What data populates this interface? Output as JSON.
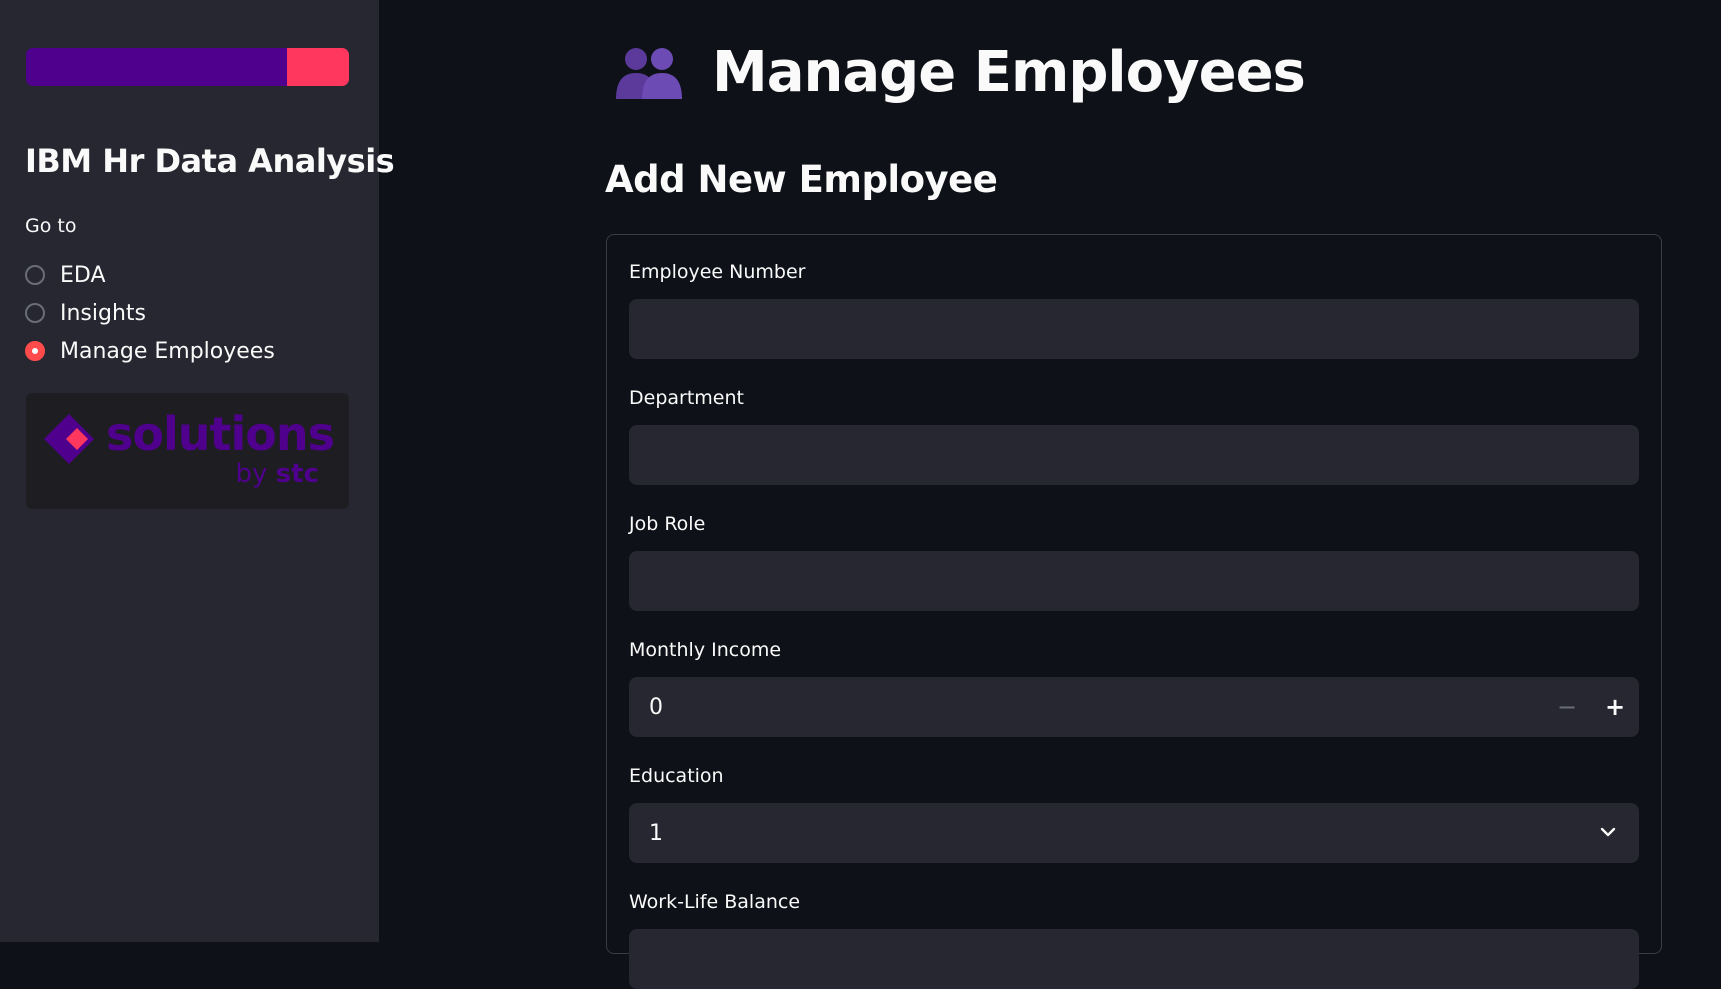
{
  "sidebar": {
    "brand_colors": [
      "#4f008c",
      "#ff375e"
    ],
    "title": "IBM Hr Data Analysis",
    "goto_label": "Go to",
    "nav": [
      {
        "label": "EDA",
        "selected": false
      },
      {
        "label": "Insights",
        "selected": false
      },
      {
        "label": "Manage Employees",
        "selected": true
      }
    ],
    "logo": {
      "word": "solutions",
      "by": "by",
      "brand": "stc"
    }
  },
  "main": {
    "title_icon": "busts-in-silhouette-icon",
    "title": "Manage Employees",
    "subtitle": "Add New Employee",
    "fields": {
      "employee_number": {
        "label": "Employee Number",
        "value": ""
      },
      "department": {
        "label": "Department",
        "value": ""
      },
      "job_role": {
        "label": "Job Role",
        "value": ""
      },
      "monthly_income": {
        "label": "Monthly Income",
        "value": "0",
        "minus": "−",
        "plus": "+"
      },
      "education": {
        "label": "Education",
        "value": "1"
      },
      "work_life_balance": {
        "label": "Work-Life Balance",
        "value": ""
      }
    }
  },
  "colors": {
    "accent": "#ff4b4b",
    "background": "#0e1117",
    "sidebar": "#262730"
  }
}
